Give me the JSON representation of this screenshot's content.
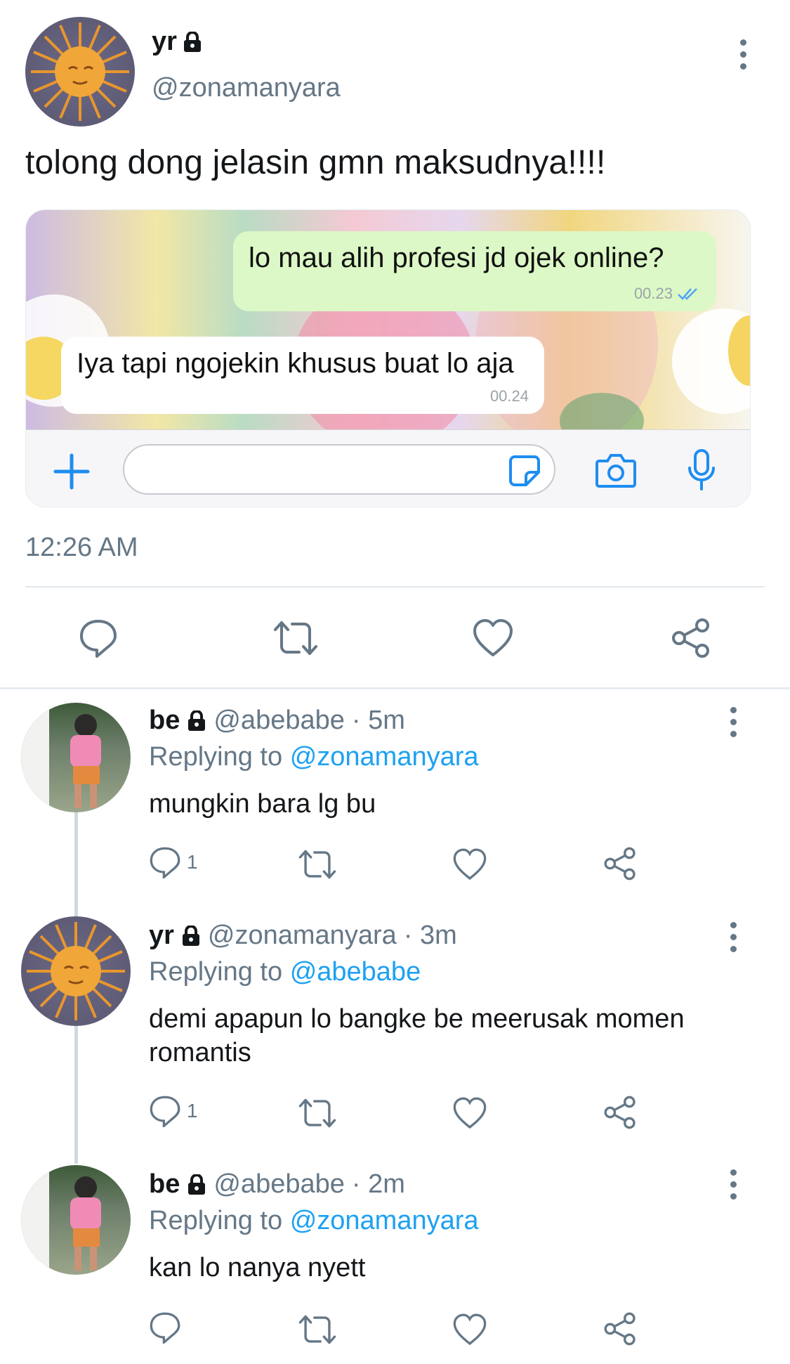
{
  "main_tweet": {
    "name": "yr",
    "handle": "@zonamanyara",
    "text": "tolong dong jelasin gmn maksudnya!!!!",
    "time": "12:26 AM",
    "icons": {
      "lock": "lock-icon",
      "more": "more-vertical-icon"
    }
  },
  "chat_image": {
    "outgoing": {
      "text": "lo mau alih profesi jd ojek online?",
      "time": "00.23"
    },
    "incoming": {
      "text": "Iya tapi ngojekin khusus buat lo aja",
      "time": "00.24"
    },
    "composer_icons": [
      "plus-icon",
      "sticker-icon",
      "camera-icon",
      "microphone-icon"
    ]
  },
  "main_actions": [
    "reply-icon",
    "retweet-icon",
    "like-icon",
    "share-icon"
  ],
  "replies": [
    {
      "name": "be",
      "handle": "@abebabe",
      "time": "· 5m",
      "replying_label": "Replying to",
      "replying_to": "@zonamanyara",
      "text": "mungkin bara lg bu",
      "reply_count": "1"
    },
    {
      "name": "yr",
      "handle": "@zonamanyara",
      "time": "· 3m",
      "replying_label": "Replying to",
      "replying_to": "@abebabe",
      "text": "demi apapun lo bangke be meerusak momen romantis",
      "reply_count": "1"
    },
    {
      "name": "be",
      "handle": "@abebabe",
      "time": "· 2m",
      "replying_label": "Replying to",
      "replying_to": "@zonamanyara",
      "text": "kan lo nanya nyett",
      "reply_count": ""
    }
  ],
  "colors": {
    "link": "#1da1f2",
    "muted": "#657786",
    "chat_out": "#dcf8c6",
    "whatsapp_blue": "#1f8df0"
  }
}
